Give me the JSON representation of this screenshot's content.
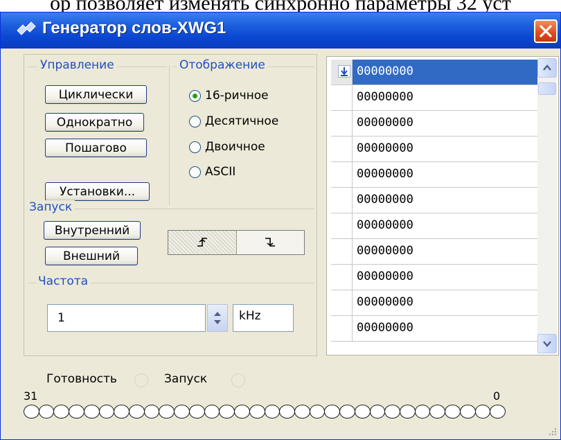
{
  "background_line": "ор позволяет изменять синхронно параметры 32 уст",
  "window": {
    "title": "Генератор слов-XWG1",
    "title_icon": "word-generator-icon",
    "close_icon": "close-icon"
  },
  "control": {
    "title": "Управление",
    "cyclic": "Циклически",
    "single": "Однократно",
    "step": "Пошагово",
    "settings": "Установки..."
  },
  "display": {
    "title": "Отображение",
    "options": [
      "16-ричное",
      "Десятичное",
      "Двоичное",
      "ASCII"
    ],
    "selected": "16-ричное"
  },
  "trigger": {
    "title": "Запуск",
    "internal": "Внутренний",
    "external": "Внешний",
    "edges": [
      "rising-edge-icon",
      "falling-edge-icon"
    ],
    "selected_edge": "rising-edge-icon"
  },
  "frequency": {
    "title": "Частота",
    "value": "1",
    "unit": "kHz"
  },
  "status": {
    "ready": "Готовность",
    "run": "Запуск"
  },
  "bits": {
    "high_label": "31",
    "low_label": "0",
    "count": 32
  },
  "words": [
    "00000000",
    "00000000",
    "00000000",
    "00000000",
    "00000000",
    "00000000",
    "00000000",
    "00000000",
    "00000000",
    "00000000",
    "00000000"
  ],
  "colors": {
    "title_bar": "#0a46d1",
    "selection": "#316ac5",
    "group_title": "#1f4fc1",
    "dialog_bg": "#ece9d8"
  }
}
